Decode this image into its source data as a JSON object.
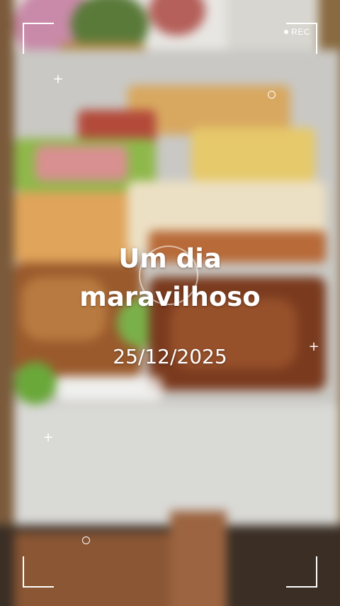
{
  "recording": {
    "label": "REC"
  },
  "overlay": {
    "title_line1": "Um dia",
    "title_line2": "maravilhoso",
    "date": "25/12/2025"
  },
  "colors": {
    "overlay_text": "#ffffff",
    "table": "#dcdcd8",
    "floor": "#3a2e25"
  },
  "icons": [
    "rec-dot-icon",
    "plus-icon",
    "circle-icon",
    "viewfinder-corner-icon"
  ]
}
